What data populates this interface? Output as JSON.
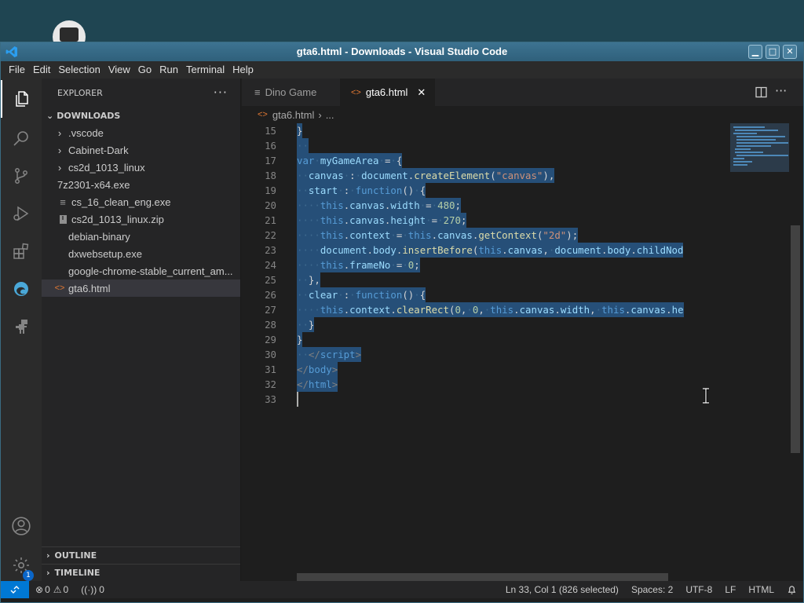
{
  "window": {
    "title": "gta6.html - Downloads - Visual Studio Code",
    "controls": {
      "minimize": "▁",
      "maximize": "□",
      "close": "✕"
    }
  },
  "menu": [
    "File",
    "Edit",
    "Selection",
    "View",
    "Go",
    "Run",
    "Terminal",
    "Help"
  ],
  "activity_bar": {
    "items": [
      "explorer-icon",
      "search-icon",
      "source-control-icon",
      "run-debug-icon",
      "extensions-icon",
      "edge-icon",
      "dino-icon"
    ],
    "bottom": [
      "account-icon",
      "settings-gear-icon"
    ],
    "settings_badge": "1"
  },
  "sidebar": {
    "header": "EXPLORER",
    "more": "···",
    "section": "DOWNLOADS",
    "items": [
      {
        "label": ".vscode",
        "type": "folder"
      },
      {
        "label": "Cabinet-Dark",
        "type": "folder"
      },
      {
        "label": "cs2d_1013_linux",
        "type": "folder"
      },
      {
        "label": "7z2301-x64.exe",
        "type": "file"
      },
      {
        "label": "cs_16_clean_eng.exe",
        "type": "file"
      },
      {
        "label": "cs2d_1013_linux.zip",
        "type": "zip"
      },
      {
        "label": "debian-binary",
        "type": "file"
      },
      {
        "label": "dxwebsetup.exe",
        "type": "file"
      },
      {
        "label": "google-chrome-stable_current_am...",
        "type": "file"
      },
      {
        "label": "gta6.html",
        "type": "html",
        "selected": true
      }
    ],
    "outline": "OUTLINE",
    "timeline": "TIMELINE"
  },
  "tabs": [
    {
      "label": "Dino Game",
      "active": false
    },
    {
      "label": "gta6.html",
      "active": true
    }
  ],
  "breadcrumb": {
    "file": "gta6.html",
    "rest": "..."
  },
  "editor": {
    "lines": [
      {
        "n": "15",
        "html": "<span class=\"p\">}</span>"
      },
      {
        "n": "16",
        "html": "<span class=\"ws\">··</span>"
      },
      {
        "n": "17",
        "html": "<span class=\"k\">var</span><span class=\"ws\">·</span><span class=\"v\">myGameArea</span><span class=\"ws\">·</span><span class=\"p\">=</span><span class=\"ws\">·</span><span class=\"p\">{</span>"
      },
      {
        "n": "18",
        "html": "<span class=\"ws\">··</span><span class=\"v\">canvas</span><span class=\"ws\">·</span><span class=\"p\">:</span><span class=\"ws\">·</span><span class=\"v\">document</span><span class=\"p\">.</span><span class=\"f\">createElement</span><span class=\"p\">(</span><span class=\"s\">\"canvas\"</span><span class=\"p\">),</span>"
      },
      {
        "n": "19",
        "html": "<span class=\"ws\">··</span><span class=\"v\">start</span><span class=\"ws\">·</span><span class=\"p\">:</span><span class=\"ws\">·</span><span class=\"k\">function</span><span class=\"p\">()</span><span class=\"ws\">·</span><span class=\"p\">{</span>"
      },
      {
        "n": "20",
        "html": "<span class=\"ws\">····</span><span class=\"k\">this</span><span class=\"p\">.</span><span class=\"v\">canvas</span><span class=\"p\">.</span><span class=\"v\">width</span><span class=\"ws\">·</span><span class=\"p\">=</span><span class=\"ws\">·</span><span class=\"n\">480</span><span class=\"p\">;</span>"
      },
      {
        "n": "21",
        "html": "<span class=\"ws\">····</span><span class=\"k\">this</span><span class=\"p\">.</span><span class=\"v\">canvas</span><span class=\"p\">.</span><span class=\"v\">height</span><span class=\"ws\">·</span><span class=\"p\">=</span><span class=\"ws\">·</span><span class=\"n\">270</span><span class=\"p\">;</span>"
      },
      {
        "n": "22",
        "html": "<span class=\"ws\">····</span><span class=\"k\">this</span><span class=\"p\">.</span><span class=\"v\">context</span><span class=\"ws\">·</span><span class=\"p\">=</span><span class=\"ws\">·</span><span class=\"k\">this</span><span class=\"p\">.</span><span class=\"v\">canvas</span><span class=\"p\">.</span><span class=\"f\">getContext</span><span class=\"p\">(</span><span class=\"s\">\"2d\"</span><span class=\"p\">);</span>"
      },
      {
        "n": "23",
        "html": "<span class=\"ws\">····</span><span class=\"v\">document</span><span class=\"p\">.</span><span class=\"v\">body</span><span class=\"p\">.</span><span class=\"f\">insertBefore</span><span class=\"p\">(</span><span class=\"k\">this</span><span class=\"p\">.</span><span class=\"v\">canvas</span><span class=\"p\">,</span><span class=\"ws\">·</span><span class=\"v\">document</span><span class=\"p\">.</span><span class=\"v\">body</span><span class=\"p\">.</span><span class=\"v\">childNod</span>"
      },
      {
        "n": "24",
        "html": "<span class=\"ws\">····</span><span class=\"k\">this</span><span class=\"p\">.</span><span class=\"v\">frameNo</span><span class=\"ws\">·</span><span class=\"p\">=</span><span class=\"ws\">·</span><span class=\"n\">0</span><span class=\"p\">;</span>"
      },
      {
        "n": "25",
        "html": "<span class=\"ws\">··</span><span class=\"p\">},</span>"
      },
      {
        "n": "26",
        "html": "<span class=\"ws\">··</span><span class=\"v\">clear</span><span class=\"ws\">·</span><span class=\"p\">:</span><span class=\"ws\">·</span><span class=\"k\">function</span><span class=\"p\">()</span><span class=\"ws\">·</span><span class=\"p\">{</span>"
      },
      {
        "n": "27",
        "html": "<span class=\"ws\">····</span><span class=\"k\">this</span><span class=\"p\">.</span><span class=\"v\">context</span><span class=\"p\">.</span><span class=\"f\">clearRect</span><span class=\"p\">(</span><span class=\"n\">0</span><span class=\"p\">,</span><span class=\"ws\">·</span><span class=\"n\">0</span><span class=\"p\">,</span><span class=\"ws\">·</span><span class=\"k\">this</span><span class=\"p\">.</span><span class=\"v\">canvas</span><span class=\"p\">.</span><span class=\"v\">width</span><span class=\"p\">,</span><span class=\"ws\">·</span><span class=\"k\">this</span><span class=\"p\">.</span><span class=\"v\">canvas</span><span class=\"p\">.</span><span class=\"v\">he</span>"
      },
      {
        "n": "28",
        "html": "<span class=\"ws\">··</span><span class=\"p\">}</span>"
      },
      {
        "n": "29",
        "html": "<span class=\"p\">}</span>"
      },
      {
        "n": "30",
        "html": "<span class=\"ws\">··</span><span class=\"t\">&lt;/</span><span class=\"k\">script</span><span class=\"t\">&gt;</span>"
      },
      {
        "n": "31",
        "html": "<span class=\"t\">&lt;/</span><span class=\"k\">body</span><span class=\"t\">&gt;</span>"
      },
      {
        "n": "32",
        "html": "<span class=\"t\">&lt;/</span><span class=\"k\">html</span><span class=\"t\">&gt;</span>"
      },
      {
        "n": "33",
        "html": ""
      }
    ]
  },
  "statusbar": {
    "errors": "0",
    "warnings": "0",
    "ports": "0",
    "position": "Ln 33, Col 1 (826 selected)",
    "spaces": "Spaces: 2",
    "encoding": "UTF-8",
    "eol": "LF",
    "language": "HTML"
  },
  "colors": {
    "accent": "#0078d4",
    "selection": "#264f78",
    "titlebar": "#2f607b"
  }
}
